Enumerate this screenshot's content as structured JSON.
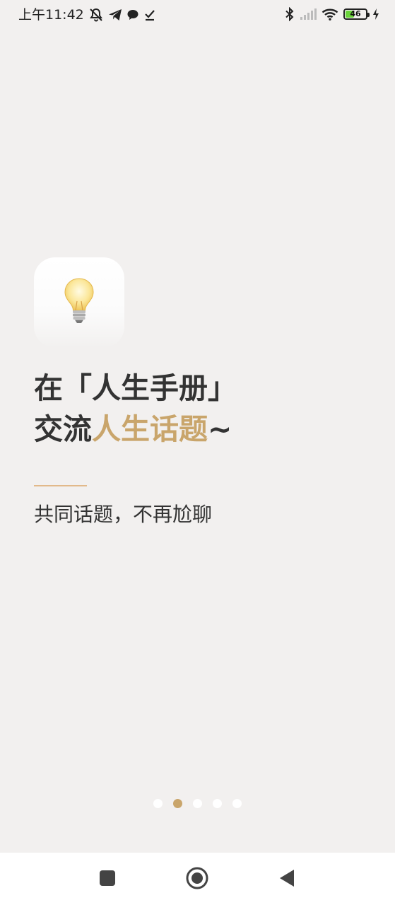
{
  "status_bar": {
    "time": "上午11:42",
    "battery_level": "46",
    "battery_fraction": 0.46,
    "left_icons": [
      "muted-notifications-icon",
      "telegram-icon",
      "chat-bubble-icon",
      "download-done-icon"
    ],
    "right_icons": [
      "bluetooth-icon",
      "signal-icon",
      "wifi-icon",
      "battery-icon",
      "charging-icon"
    ]
  },
  "onboarding": {
    "app_icon": "lightbulb-icon",
    "headline_line1": "在「人生手册」",
    "headline_line2_prefix": "交流",
    "headline_line2_accent": "人生话题",
    "headline_line2_suffix": "~",
    "subtitle": "共同话题，不再尬聊",
    "accent_color": "#c9a56b",
    "divider_color": "#e2b98a"
  },
  "pagination": {
    "total": 5,
    "active_index": 1
  },
  "nav_bar": {
    "buttons": [
      "recent-apps-icon",
      "home-icon",
      "back-icon"
    ]
  }
}
